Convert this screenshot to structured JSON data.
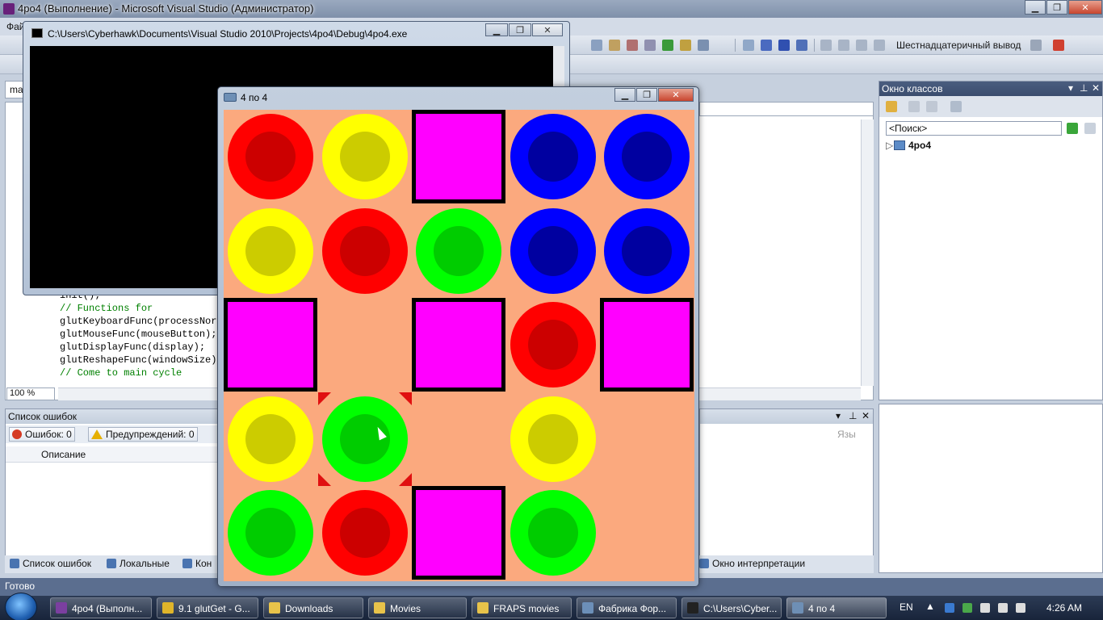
{
  "vs": {
    "title": "4po4 (Выполнение) - Microsoft Visual Studio (Администратор)",
    "menu_first": "Фай",
    "toolbar_hex_label": "Шестнадцатеричный вывод",
    "editor_tab": "ma",
    "zoom": "100 %",
    "code": {
      "l1": "init();",
      "l2": "// Functions for",
      "l3": "glutKeyboardFunc(processNorm",
      "l4": "glutMouseFunc(mouseButton);",
      "l5": "glutDisplayFunc(display);",
      "l6": "glutReshapeFunc(windowSize);",
      "l7": "// Come to main cycle"
    },
    "class_view": {
      "title": "Окно классов",
      "search_placeholder": "<Поиск>",
      "tree_item": "4po4"
    },
    "error_list": {
      "title": "Список ошибок",
      "errors_label": "Ошибок: 0",
      "warnings_label": "Предупреждений: 0",
      "description_col": "Описание"
    },
    "bottom_tabs": {
      "errors": "Список ошибок",
      "locals": "Локальные",
      "kon": "Кон",
      "immediate": "Окно интерпретации"
    },
    "immediate_col": "Язы",
    "status": "Готово"
  },
  "console": {
    "title": "C:\\Users\\Cyberhawk\\Documents\\Visual Studio 2010\\Projects\\4po4\\Debug\\4po4.exe"
  },
  "game": {
    "title": "4 по 4",
    "colors": {
      "background": "#fba97e",
      "red_outer": "#ff0000",
      "red_inner": "#cc0000",
      "yellow_outer": "#ffff00",
      "yellow_inner": "#cccc00",
      "green_outer": "#00ff00",
      "green_inner": "#00cc00",
      "blue_outer": "#0000ff",
      "blue_inner": "#0000a0",
      "block": "#ff00ff"
    },
    "grid": [
      [
        "red",
        "yellow",
        "block",
        "blue",
        "blue"
      ],
      [
        "yellow",
        "red",
        "green",
        "blue",
        "blue"
      ],
      [
        "block",
        "empty",
        "block",
        "red",
        "block"
      ],
      [
        "yellow",
        "green",
        "empty",
        "yellow",
        "empty"
      ],
      [
        "green",
        "red",
        "block",
        "green",
        "empty"
      ]
    ],
    "selected_cell": {
      "row": 3,
      "col": 1
    }
  },
  "taskbar": {
    "tasks": [
      {
        "label": "4po4 (Выполн...",
        "icon": "visual-studio-icon",
        "color": "#7b3fa0"
      },
      {
        "label": "9.1 glutGet - G...",
        "icon": "chrome-icon",
        "color": "#e0b52a"
      },
      {
        "label": "Downloads",
        "icon": "folder-icon",
        "color": "#e8c34a"
      },
      {
        "label": "Movies",
        "icon": "folder-icon",
        "color": "#e8c34a"
      },
      {
        "label": "FRAPS movies",
        "icon": "folder-icon",
        "color": "#e8c34a"
      },
      {
        "label": "Фабрика Фор...",
        "icon": "format-factory-icon",
        "color": "#6c8fb8"
      },
      {
        "label": "C:\\Users\\Cyber...",
        "icon": "console-icon",
        "color": "#222222"
      },
      {
        "label": "4 по 4",
        "icon": "glut-window-icon",
        "color": "#6e8fb5"
      }
    ],
    "lang": "EN",
    "clock": "4:26 AM"
  }
}
